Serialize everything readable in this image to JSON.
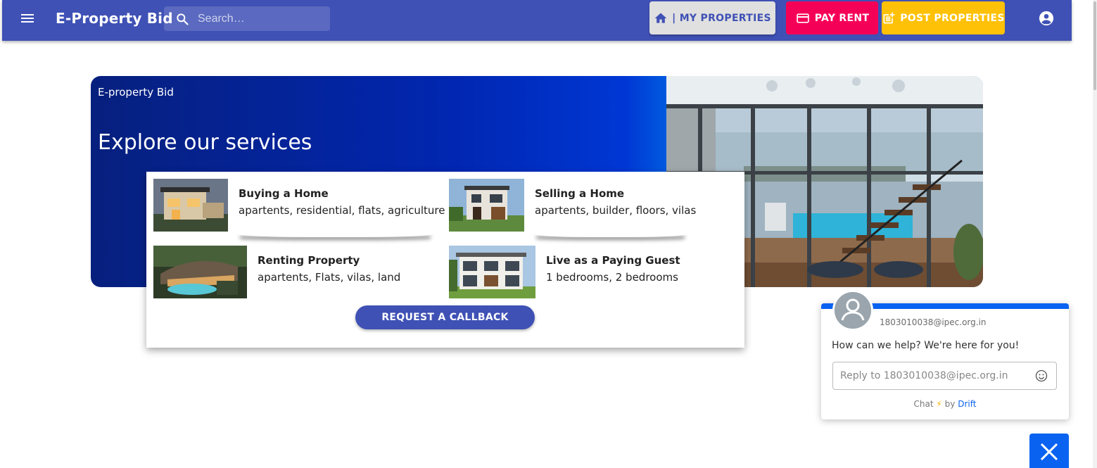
{
  "appbar": {
    "brand": "E-Property Bid",
    "search_placeholder": "Search…",
    "my_properties": "| MY PROPERTIES",
    "pay_rent": "PAY RENT",
    "post_properties": "POST PROPERTIES",
    "color": "#3f51b5"
  },
  "hero": {
    "subtitle": "E-property Bid",
    "title": "Explore our services"
  },
  "services": {
    "items": [
      {
        "title": "Buying a Home",
        "desc": "apartents, residential, flats, agriculture"
      },
      {
        "title": "Selling a Home",
        "desc": "apartents, builder, floors, vilas"
      },
      {
        "title": "Renting Property",
        "desc": "apartents, Flats, vilas, land"
      },
      {
        "title": "Live as a Paying Guest",
        "desc": "1 bedrooms, 2 bedrooms"
      }
    ],
    "callback": "REQUEST A CALLBACK"
  },
  "chat": {
    "email": "1803010038@ipec.org.in",
    "message": "How can we help? We're here for you!",
    "reply_placeholder": "Reply to 1803010038@ipec.org.in",
    "footer_chat": "Chat",
    "footer_by": "by",
    "footer_drift": "Drift"
  }
}
